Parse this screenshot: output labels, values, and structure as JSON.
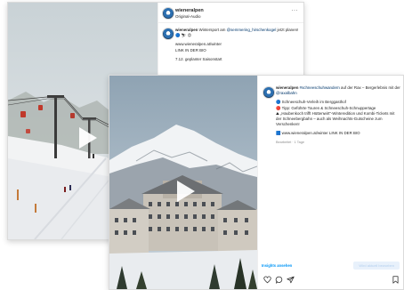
{
  "back_post": {
    "username": "wieneralpen",
    "subtitle": "Original-Audio",
    "more_label": "···",
    "caption_username": "wieneralpen",
    "caption_text_before": " Wintersport am ",
    "caption_mention": "@semmering_hirschenkogel",
    "caption_text_after": " jetzt planen!",
    "caption_emojis": "🔵 ⛷ 😍",
    "caption_url": "www.wieneralpen.at/winter",
    "caption_link_in_bio": "LINK IN DER BIO",
    "caption_date_line": "7.12. geplanter Saisonstart"
  },
  "front_post": {
    "caption_username": "wieneralpen",
    "caption_hashtag": "#schneeschuhwandern",
    "caption_text_mid": " auf der Rax – Bergerlebnis mit der ",
    "caption_mention": "@raxalbahn",
    "lines": [
      "🔵 Schneeschuh-Verleih im Berggasthof",
      "🔴 Tipp: Geführte Touren & Schneeschuh-Schnuppertage",
      "⛰ „Haubenkoch trifft Hüttenwirt“-Winteredition und Kombi-Tickets mit der Schneebergbahn – auch als Weihnachts-Gutscheine zum Verschenken!"
    ],
    "url_line": "🟦 www.wieneralpen.at/winter LINK IN DER BIO",
    "meta": "Bearbeitet · 1 Tage",
    "insights_label": "Insights ansehen",
    "promote_label": "Wird aktuell beworben"
  },
  "icons": [
    "heart-icon",
    "comment-icon",
    "share-icon",
    "bookmark-icon",
    "play-icon"
  ],
  "colors": {
    "link": "#00376b",
    "accent": "#0095f6"
  }
}
